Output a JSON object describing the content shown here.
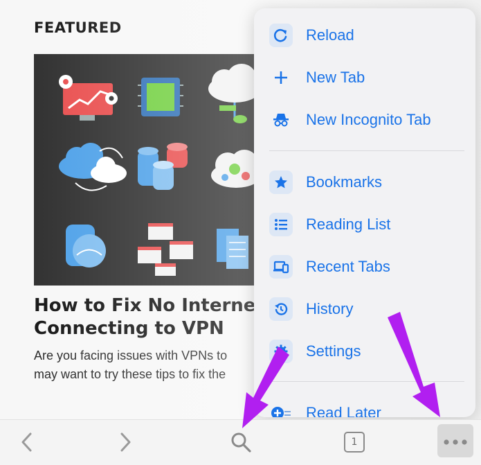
{
  "article": {
    "section_title": "FEATURED",
    "headline_line1": "How to Fix No Internet C",
    "headline_line2": "Connecting to VPN",
    "excerpt_line1": "Are you facing issues with VPNs to",
    "excerpt_line2": "may want to try these tips to fix the"
  },
  "menu": {
    "items": [
      {
        "label": "Reload",
        "icon": "reload-icon"
      },
      {
        "label": "New Tab",
        "icon": "plus-icon"
      },
      {
        "label": "New Incognito Tab",
        "icon": "incognito-icon"
      },
      {
        "label": "Bookmarks",
        "icon": "star-icon"
      },
      {
        "label": "Reading List",
        "icon": "list-icon"
      },
      {
        "label": "Recent Tabs",
        "icon": "devices-icon"
      },
      {
        "label": "History",
        "icon": "history-icon"
      },
      {
        "label": "Settings",
        "icon": "gear-icon"
      },
      {
        "label": "Read Later",
        "icon": "read-later-icon"
      }
    ]
  },
  "toolbar": {
    "tab_count": "1",
    "icons": [
      "back-icon",
      "forward-icon",
      "search-icon",
      "tab-switcher-icon",
      "more-icon"
    ]
  },
  "colors": {
    "accent": "#1a73e8",
    "annotation_arrow": "#b11ff0"
  }
}
